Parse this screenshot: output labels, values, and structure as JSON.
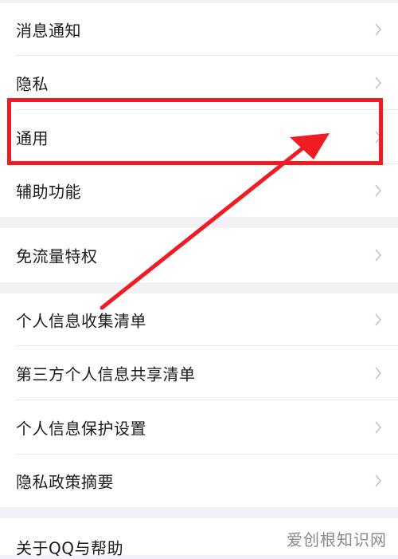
{
  "settings": {
    "items": [
      {
        "label": "消息通知"
      },
      {
        "label": "隐私"
      },
      {
        "label": "通用"
      },
      {
        "label": "辅助功能"
      },
      {
        "label": "免流量特权"
      },
      {
        "label": "个人信息收集清单"
      },
      {
        "label": "第三方个人信息共享清单"
      },
      {
        "label": "个人信息保护设置"
      },
      {
        "label": "隐私政策摘要"
      },
      {
        "label": "关于QQ与帮助"
      }
    ]
  },
  "annotation": {
    "color": "#ee1c24",
    "highlighted_item": "通用"
  },
  "watermark": {
    "text": "爱创根知识网"
  },
  "colors": {
    "background": "#f2f2f6",
    "row": "#ffffff",
    "text": "#1b1b1b",
    "chevron": "#c4c4c8",
    "accent": "#ee1c24"
  }
}
